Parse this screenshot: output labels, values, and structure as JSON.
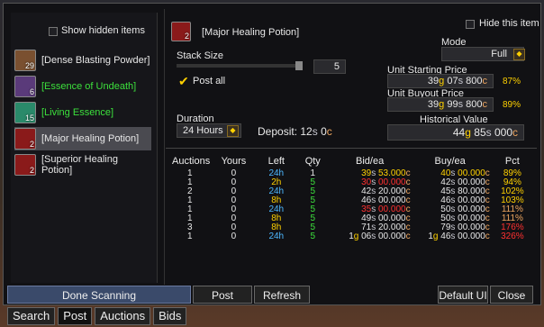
{
  "left": {
    "show_hidden_label": "Show hidden items",
    "items": [
      {
        "name": "[Dense Blasting Powder]",
        "count": "29",
        "color": "#e8e8e8",
        "icon": "blasting-powder-icon",
        "bg": "#7a5030"
      },
      {
        "name": "[Essence of Undeath]",
        "count": "6",
        "color": "#3ce03c",
        "icon": "essence-undeath-icon",
        "bg": "#5a3a7a"
      },
      {
        "name": "[Living Essence]",
        "count": "15",
        "color": "#3ce03c",
        "icon": "living-essence-icon",
        "bg": "#2a8a6a"
      },
      {
        "name": "[Major Healing Potion]",
        "count": "2",
        "color": "#e8e8e8",
        "icon": "potion-icon",
        "bg": "#8a1a1a"
      },
      {
        "name": "[Superior Healing Potion]",
        "count": "2",
        "color": "#e8e8e8",
        "icon": "potion-icon",
        "bg": "#8a1a1a"
      }
    ]
  },
  "header": {
    "item_name": "[Major Healing Potion]",
    "item_count": "2",
    "hide_label": "Hide this item"
  },
  "settings": {
    "stack_size_label": "Stack Size",
    "stack_size_value": "5",
    "post_all_label": "Post all",
    "mode_label": "Mode",
    "mode_value": "Full",
    "unit_start_label": "Unit Starting Price",
    "unit_start_g": "39",
    "unit_start_s": "07",
    "unit_start_c": "800",
    "unit_start_pct": "87%",
    "unit_buyout_label": "Unit Buyout Price",
    "unit_buyout_g": "39",
    "unit_buyout_s": "99",
    "unit_buyout_c": "800",
    "unit_buyout_pct": "89%",
    "duration_label": "Duration",
    "duration_value": "24 Hours",
    "deposit_label": "Deposit:",
    "deposit_s": "12",
    "deposit_c": "0",
    "hist_label": "Historical Value",
    "hist_g": "44",
    "hist_s": "85",
    "hist_c": "000"
  },
  "table": {
    "headers": [
      "Auctions",
      "Yours",
      "Left",
      "Qty",
      "Bid/ea",
      "Buy/ea",
      "Pct"
    ],
    "rows": [
      {
        "auctions": "1",
        "yours": "0",
        "left": "24h",
        "left_color": "#4db8ff",
        "qty": "1",
        "qty_color": "#e8e8e8",
        "bid_g": "",
        "bid_s": "39",
        "bid_c": "53.000",
        "bid_color": "#ffd100",
        "buy_s": "40",
        "buy_c": "00.000",
        "buy_color": "#ffd100",
        "pct": "89%",
        "pct_color": "#ffd100"
      },
      {
        "auctions": "1",
        "yours": "0",
        "left": "2h",
        "left_color": "#ffd100",
        "qty": "5",
        "qty_color": "#3ce03c",
        "bid_g": "",
        "bid_s": "30",
        "bid_c": "00.000",
        "bid_color": "#ff3030",
        "buy_s": "42",
        "buy_c": "00.000",
        "buy_color": "#e8e8e8",
        "pct": "94%",
        "pct_color": "#ffd100"
      },
      {
        "auctions": "2",
        "yours": "0",
        "left": "24h",
        "left_color": "#4db8ff",
        "qty": "5",
        "qty_color": "#3ce03c",
        "bid_g": "",
        "bid_s": "42",
        "bid_c": "20.000",
        "bid_color": "#e8e8e8",
        "buy_s": "45",
        "buy_c": "80.000",
        "buy_color": "#e8e8e8",
        "pct": "102%",
        "pct_color": "#ffd100"
      },
      {
        "auctions": "1",
        "yours": "0",
        "left": "8h",
        "left_color": "#ffd100",
        "qty": "5",
        "qty_color": "#3ce03c",
        "bid_g": "",
        "bid_s": "46",
        "bid_c": "00.000",
        "bid_color": "#e8e8e8",
        "buy_s": "46",
        "buy_c": "00.000",
        "buy_color": "#e8e8e8",
        "pct": "103%",
        "pct_color": "#ffd100"
      },
      {
        "auctions": "1",
        "yours": "0",
        "left": "24h",
        "left_color": "#4db8ff",
        "qty": "5",
        "qty_color": "#3ce03c",
        "bid_g": "",
        "bid_s": "35",
        "bid_c": "00.000",
        "bid_color": "#ff3030",
        "buy_s": "50",
        "buy_c": "00.000",
        "buy_color": "#e8e8e8",
        "pct": "111%",
        "pct_color": "#eda55f"
      },
      {
        "auctions": "1",
        "yours": "0",
        "left": "8h",
        "left_color": "#ffd100",
        "qty": "5",
        "qty_color": "#3ce03c",
        "bid_g": "",
        "bid_s": "49",
        "bid_c": "00.000",
        "bid_color": "#e8e8e8",
        "buy_s": "50",
        "buy_c": "00.000",
        "buy_color": "#e8e8e8",
        "pct": "111%",
        "pct_color": "#eda55f"
      },
      {
        "auctions": "3",
        "yours": "0",
        "left": "8h",
        "left_color": "#ffd100",
        "qty": "5",
        "qty_color": "#3ce03c",
        "bid_g": "",
        "bid_s": "71",
        "bid_c": "20.000",
        "bid_color": "#e8e8e8",
        "buy_s": "79",
        "buy_c": "00.000",
        "buy_color": "#e8e8e8",
        "pct": "176%",
        "pct_color": "#ff3030"
      },
      {
        "auctions": "1",
        "yours": "0",
        "left": "24h",
        "left_color": "#4db8ff",
        "qty": "5",
        "qty_color": "#3ce03c",
        "bid_g": "1",
        "bid_s": "06",
        "bid_c": "00.000",
        "bid_color": "#e8e8e8",
        "buy_g": "1",
        "buy_s": "46",
        "buy_c": "00.000",
        "buy_color": "#e8e8e8",
        "pct": "326%",
        "pct_color": "#ff3030"
      }
    ]
  },
  "buttons": {
    "done_scanning": "Done Scanning",
    "post": "Post",
    "refresh": "Refresh",
    "default_ui": "Default UI",
    "close": "Close"
  },
  "tabs": [
    "Search",
    "Post",
    "Auctions",
    "Bids"
  ],
  "currency": {
    "g": "g",
    "s": "s",
    "c": "c"
  }
}
